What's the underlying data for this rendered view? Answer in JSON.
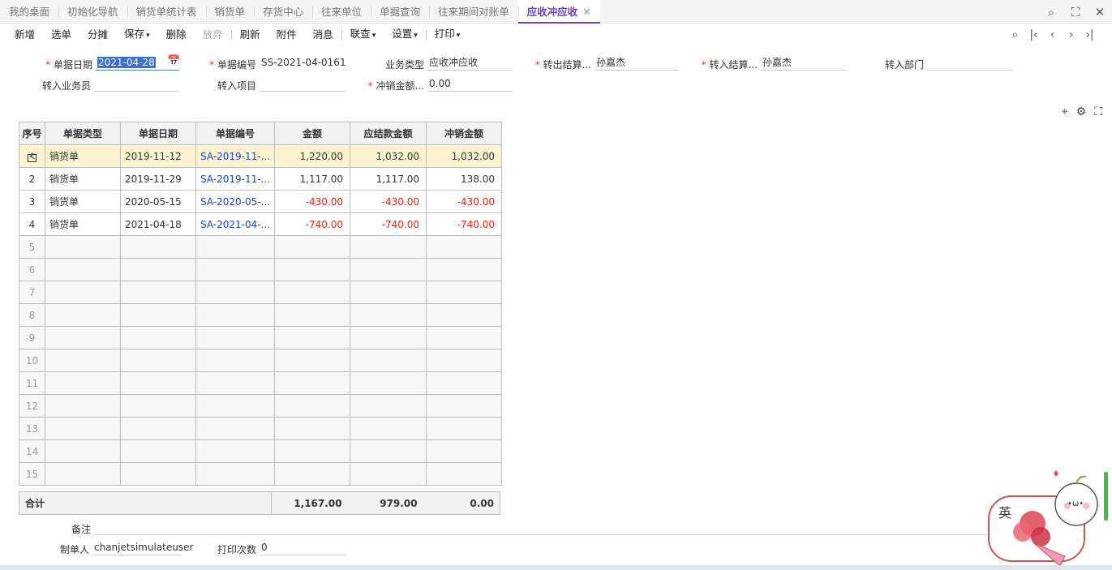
{
  "tabs": [
    {
      "label": "我的桌面",
      "active": false
    },
    {
      "label": "初始化导航",
      "active": false
    },
    {
      "label": "销货单统计表",
      "active": false
    },
    {
      "label": "销货单",
      "active": false
    },
    {
      "label": "存货中心",
      "active": false
    },
    {
      "label": "往来单位",
      "active": false
    },
    {
      "label": "单据查询",
      "active": false
    },
    {
      "label": "往来期间对账单",
      "active": false
    },
    {
      "label": "应收冲应收",
      "active": true
    }
  ],
  "tab_close": "✕",
  "toolbar": {
    "new": "新增",
    "select": "选单",
    "allocate": "分摊",
    "save": "保存",
    "delete": "删除",
    "discard": "放弃",
    "refresh": "刷新",
    "attach": "附件",
    "message": "消息",
    "linkquery": "联查",
    "settings": "设置",
    "print": "打印"
  },
  "form": {
    "date": {
      "label": "单据日期",
      "value": "2021-04-28"
    },
    "docno": {
      "label": "单据编号",
      "value": "SS-2021-04-0161"
    },
    "biztype": {
      "label": "业务类型",
      "value": "应收冲应收"
    },
    "out_settle": {
      "label": "转出结算...",
      "value": "孙嘉杰"
    },
    "in_settle": {
      "label": "转入结算...",
      "value": "孙嘉杰"
    },
    "in_dept": {
      "label": "转入部门",
      "value": ""
    },
    "in_staff": {
      "label": "转入业务员",
      "value": ""
    },
    "in_project": {
      "label": "转入项目",
      "value": ""
    },
    "offset_amt": {
      "label": "冲销金额...",
      "value": "0.00"
    }
  },
  "table": {
    "headers": [
      "序号",
      "单据类型",
      "单据日期",
      "单据编号",
      "金额",
      "应结款金额",
      "冲销金额"
    ],
    "selected_mark": "ᢵ",
    "rows": [
      {
        "no": "1",
        "type": "销货单",
        "date": "2019-11-12",
        "docno": "SA-2019-11-...",
        "amount": "1,220.00",
        "due": "1,032.00",
        "offset": "1,032.00",
        "neg": false
      },
      {
        "no": "2",
        "type": "销货单",
        "date": "2019-11-29",
        "docno": "SA-2019-11-...",
        "amount": "1,117.00",
        "due": "1,117.00",
        "offset": "138.00",
        "neg": false
      },
      {
        "no": "3",
        "type": "销货单",
        "date": "2020-05-15",
        "docno": "SA-2020-05-...",
        "amount": "-430.00",
        "due": "-430.00",
        "offset": "-430.00",
        "neg": true
      },
      {
        "no": "4",
        "type": "销货单",
        "date": "2021-04-18",
        "docno": "SA-2021-04-...",
        "amount": "-740.00",
        "due": "-740.00",
        "offset": "-740.00",
        "neg": true
      }
    ],
    "empty_rows": [
      "5",
      "6",
      "7",
      "8",
      "9",
      "10",
      "11",
      "12",
      "13",
      "14",
      "15"
    ],
    "total": {
      "label": "合计",
      "amount": "1,167.00",
      "due": "979.00",
      "offset": "0.00"
    }
  },
  "footer": {
    "remark_label": "备注",
    "remark_value": "",
    "maker_label": "制单人",
    "maker_value": "chanjetsimulateuser",
    "print_label": "打印次数",
    "print_value": "0"
  },
  "mascot_text": "英"
}
